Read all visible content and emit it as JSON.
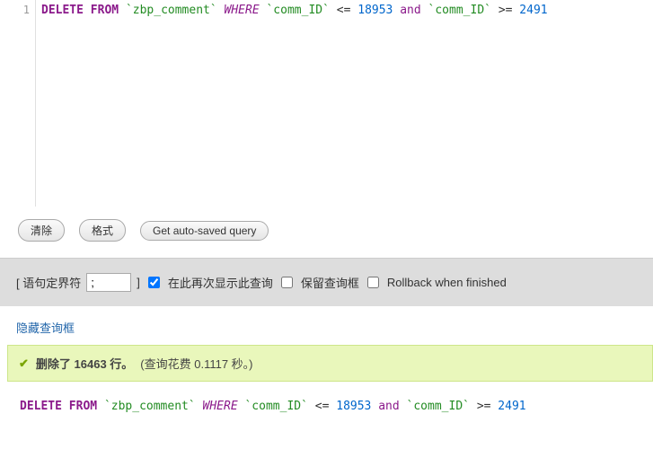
{
  "editor": {
    "line_number": "1",
    "sql": {
      "kw_delete": "DELETE",
      "kw_from": "FROM",
      "table": "`zbp_comment`",
      "kw_where": "WHERE",
      "col": "`comm_ID`",
      "op_lte": "<=",
      "val1": "18953",
      "kw_and": "and",
      "op_gte": ">=",
      "val2": "2491"
    }
  },
  "buttons": {
    "clear": "清除",
    "format": "格式",
    "autosaved": "Get auto-saved query"
  },
  "options": {
    "delim_open": "[ 语句定界符",
    "delim_value": ";",
    "delim_close": "]",
    "redisplay": "在此再次显示此查询",
    "retain": "保留查询框",
    "rollback": "Rollback when finished"
  },
  "link": {
    "hide_query": "隐藏查询框"
  },
  "result": {
    "deleted_rows_label": "删除了 16463 行。",
    "timing": "(查询花费 0.1117 秒。)"
  },
  "chart_data": {
    "type": "table",
    "title": "SQL DELETE result",
    "query": "DELETE FROM `zbp_comment` WHERE `comm_ID` <= 18953 and `comm_ID` >= 2491",
    "rows_deleted": 16463,
    "elapsed_seconds": 0.1117,
    "range": {
      "comm_ID_min": 2491,
      "comm_ID_max": 18953
    }
  }
}
